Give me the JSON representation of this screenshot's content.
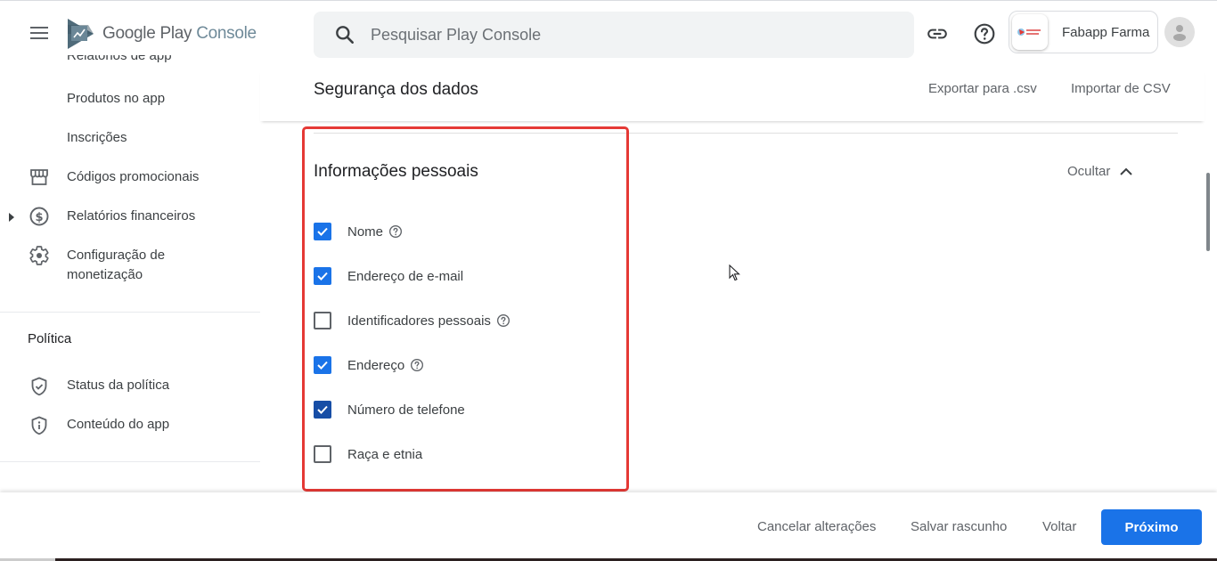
{
  "header": {
    "logo_text_main": "Google Play",
    "logo_text_console": "Console",
    "search_placeholder": "Pesquisar Play Console",
    "search_value": "",
    "app_name": "Fabapp Farma",
    "icons": {
      "menu": "menu-icon",
      "search": "search-icon",
      "link": "link-icon",
      "help": "help-circle-icon",
      "avatar": "account-avatar-icon"
    }
  },
  "sidebar": {
    "partial_item": "Relatórios de app",
    "items": [
      {
        "label": "Produtos no app",
        "icon": null
      },
      {
        "label": "Inscrições",
        "icon": null
      },
      {
        "label": "Códigos promocionais",
        "icon": "storefront-icon"
      },
      {
        "label": "Relatórios financeiros",
        "icon": "dollar-circle-icon",
        "expandable": true
      },
      {
        "label": "Configuração de monetização",
        "label_line1": "Configuração de",
        "label_line2": "monetização",
        "icon": "gear-icon"
      }
    ],
    "policy_section": {
      "title": "Política",
      "items": [
        {
          "label": "Status da política",
          "icon": "shield-check-icon"
        },
        {
          "label": "Conteúdo do app",
          "icon": "shield-info-icon"
        }
      ]
    }
  },
  "main": {
    "page_title": "Segurança dos dados",
    "export_label": "Exportar para .csv",
    "import_label": "Importar de CSV",
    "section": {
      "title": "Informações pessoais",
      "toggle_label": "Ocultar",
      "checkboxes": [
        {
          "label": "Nome",
          "checked": true,
          "help": true
        },
        {
          "label": "Endereço de e-mail",
          "checked": true,
          "help": false
        },
        {
          "label": "Identificadores pessoais",
          "checked": false,
          "help": true
        },
        {
          "label": "Endereço",
          "checked": true,
          "help": true
        },
        {
          "label": "Número de telefone",
          "checked": true,
          "help": false,
          "focused": true
        },
        {
          "label": "Raça e etnia",
          "checked": false,
          "help": false
        }
      ]
    }
  },
  "footer": {
    "cancel_label": "Cancelar alterações",
    "draft_label": "Salvar rascunho",
    "back_label": "Voltar",
    "next_label": "Próximo"
  },
  "colors": {
    "accent": "#1a73e8",
    "highlight": "#e53935",
    "text_primary": "#202124",
    "text_secondary": "#5f6368"
  }
}
